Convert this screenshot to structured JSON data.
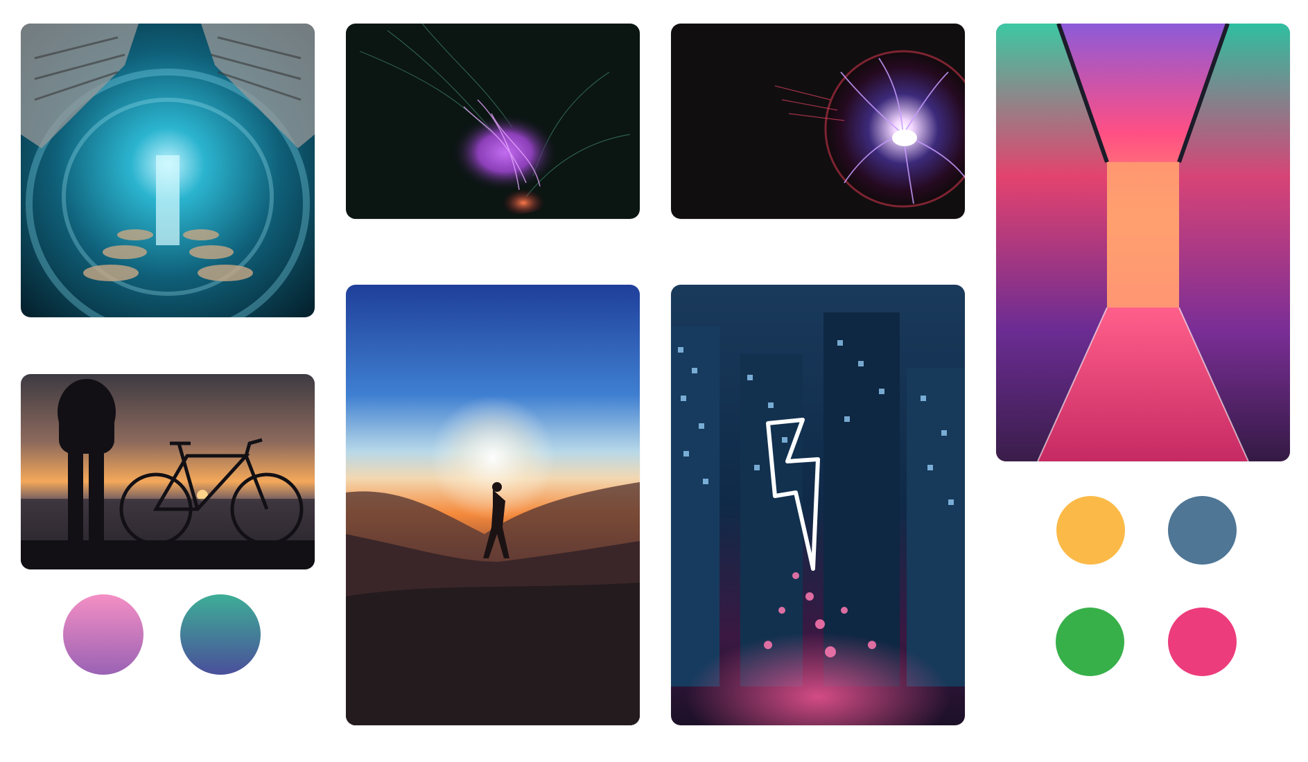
{
  "board": {
    "photos": [
      {
        "subject": "sci-fi-tunnel-photo"
      },
      {
        "subject": "abstract-light-sculpture-photo"
      },
      {
        "subject": "plasma-ball-photo"
      },
      {
        "subject": "neon-corridor-photo"
      },
      {
        "subject": "sunset-bicycle-silhouette-photo"
      },
      {
        "subject": "sunset-hiker-silhouette-photo"
      },
      {
        "subject": "neon-lightning-city-photo"
      }
    ],
    "swatches": {
      "left": [
        {
          "name": "pink-purple-gradient",
          "from": "#F48FC4",
          "to": "#9A62B4"
        },
        {
          "name": "teal-indigo-gradient",
          "from": "#3EAE97",
          "to": "#4A4F9A"
        }
      ],
      "right": [
        {
          "name": "amber",
          "color": "#FBBA48"
        },
        {
          "name": "slate-blue",
          "color": "#4F7695"
        },
        {
          "name": "green",
          "color": "#38B04A"
        },
        {
          "name": "pink",
          "color": "#EC3C7C"
        }
      ]
    }
  }
}
